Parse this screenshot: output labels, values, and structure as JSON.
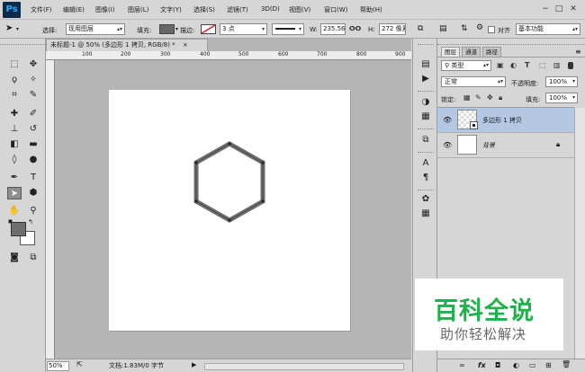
{
  "app": {
    "logo": "Ps"
  },
  "menu": [
    "文件(F)",
    "编辑(E)",
    "图像(I)",
    "图层(L)",
    "文字(Y)",
    "选择(S)",
    "滤镜(T)",
    "3D(D)",
    "视图(V)",
    "窗口(W)",
    "帮助(H)"
  ],
  "window_controls": {
    "minimize": "−",
    "maximize": "□",
    "close": "✕"
  },
  "options": {
    "select_label": "选择:",
    "select_value": "现用图层",
    "fill_label": "填充:",
    "stroke_label": "描边:",
    "stroke_width": "3 点",
    "w_label": "W:",
    "w_value": "235.56",
    "link_glyph": "ⵔⵔ",
    "h_label": "H:",
    "h_value": "272 像素",
    "align_label": "对齐",
    "workspace": "基本功能"
  },
  "document": {
    "tab_title": "未标题-1 @ 50% (多边形 1 拷贝, RGB/8) *",
    "tab_close": "×",
    "ruler_marks": [
      "100",
      "200",
      "300",
      "400",
      "500",
      "600",
      "700",
      "800",
      "900"
    ],
    "zoom": "50%",
    "doc_info": "文档:1.83M/0 字节"
  },
  "panel": {
    "tabs": [
      "图层",
      "通道",
      "路径"
    ],
    "filter_kind": "类型",
    "blend_mode": "正常",
    "opacity_label": "不透明度:",
    "opacity_value": "100%",
    "lock_label": "锁定:",
    "fill_label": "填充:",
    "fill_value": "100%",
    "layers": [
      {
        "name": "多边形 1 拷贝",
        "selected": true
      },
      {
        "name": "背景",
        "selected": false
      }
    ],
    "bottom_icons": [
      "∞",
      "fx",
      "◘",
      "◐",
      "▭",
      "⊞",
      "🗑"
    ]
  },
  "watermark": {
    "title": "百科全说",
    "subtitle": "助你轻松解决"
  },
  "colors": {
    "accent": "#31a8ff",
    "selected_layer": "#b4c7e3",
    "watermark_green": "#20b24a",
    "hexagon": "#6e6e6e"
  }
}
